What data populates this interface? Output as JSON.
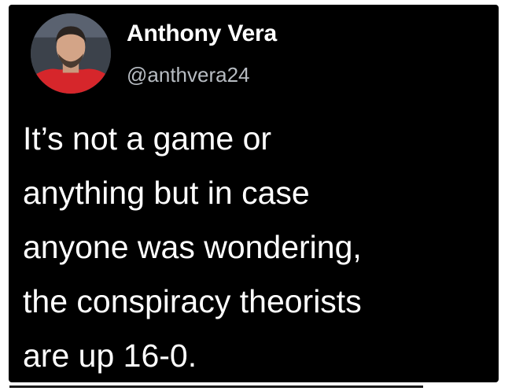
{
  "tweet": {
    "author": {
      "display_name": "Anthony Vera",
      "handle": "@anthvera24",
      "avatar_icon": "profile-photo"
    },
    "text_lines": [
      "It’s not a game or",
      "anything but in case",
      "anyone was wondering,",
      "the conspiracy theorists",
      "are up 16-0."
    ]
  },
  "colors": {
    "card_background": "#000000",
    "text": "#ffffff",
    "handle": "#b7bcc2",
    "page_background": "#ffffff"
  }
}
